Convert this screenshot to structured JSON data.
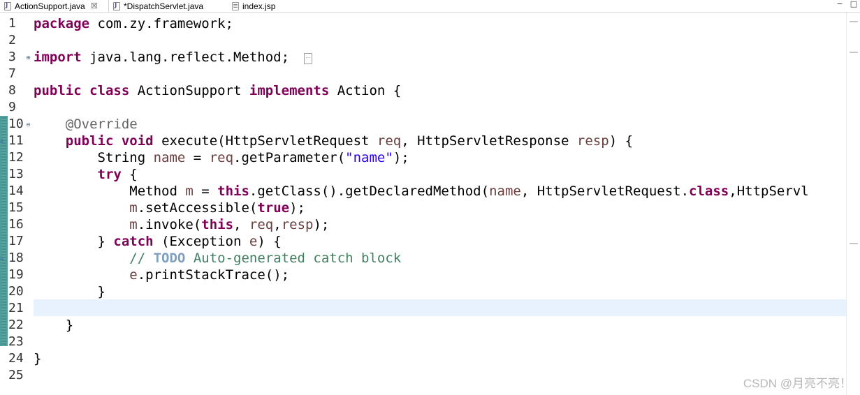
{
  "tabs": [
    {
      "label": "ActionSupport.java",
      "icon": "java-file-icon",
      "active": true,
      "close": "☒"
    },
    {
      "label": "*DispatchServlet.java",
      "icon": "java-file-icon",
      "active": false
    },
    {
      "label": "index.jsp",
      "icon": "jsp-file-icon",
      "active": false
    }
  ],
  "window_controls": {
    "minimize": "−",
    "maximize": "□"
  },
  "editor": {
    "current_line": 21,
    "lines": [
      {
        "n": "1"
      },
      {
        "n": "2"
      },
      {
        "n": "3"
      },
      {
        "n": "7"
      },
      {
        "n": "8"
      },
      {
        "n": "9"
      },
      {
        "n": "10"
      },
      {
        "n": "11"
      },
      {
        "n": "12"
      },
      {
        "n": "13"
      },
      {
        "n": "14"
      },
      {
        "n": "15"
      },
      {
        "n": "16"
      },
      {
        "n": "17"
      },
      {
        "n": "18"
      },
      {
        "n": "19"
      },
      {
        "n": "20"
      },
      {
        "n": "21"
      },
      {
        "n": "22"
      },
      {
        "n": "23"
      },
      {
        "n": "24"
      },
      {
        "n": "25"
      }
    ],
    "tokens": {
      "l1": [
        [
          "kw",
          "package"
        ],
        [
          "plain",
          " com.zy.framework;"
        ]
      ],
      "l3": [
        [
          "kw",
          "import"
        ],
        [
          "plain",
          " java.lang.reflect.Method;"
        ]
      ],
      "l8": [
        [
          "kw",
          "public"
        ],
        [
          "plain",
          " "
        ],
        [
          "kw",
          "class"
        ],
        [
          "plain",
          " ActionSupport "
        ],
        [
          "kw",
          "implements"
        ],
        [
          "plain",
          " Action {"
        ]
      ],
      "l10": [
        [
          "plain",
          "    "
        ],
        [
          "ann",
          "@Override"
        ]
      ],
      "l11": [
        [
          "plain",
          "    "
        ],
        [
          "kw",
          "public"
        ],
        [
          "plain",
          " "
        ],
        [
          "kw",
          "void"
        ],
        [
          "plain",
          " execute(HttpServletRequest "
        ],
        [
          "var",
          "req"
        ],
        [
          "plain",
          ", HttpServletResponse "
        ],
        [
          "var",
          "resp"
        ],
        [
          "plain",
          ") {"
        ]
      ],
      "l12": [
        [
          "plain",
          "        String "
        ],
        [
          "var",
          "name"
        ],
        [
          "plain",
          " = "
        ],
        [
          "var",
          "req"
        ],
        [
          "plain",
          ".getParameter("
        ],
        [
          "str",
          "\"name\""
        ],
        [
          "plain",
          ");"
        ]
      ],
      "l13": [
        [
          "plain",
          "        "
        ],
        [
          "kw",
          "try"
        ],
        [
          "plain",
          " {"
        ]
      ],
      "l14": [
        [
          "plain",
          "            Method "
        ],
        [
          "var",
          "m"
        ],
        [
          "plain",
          " = "
        ],
        [
          "kw",
          "this"
        ],
        [
          "plain",
          ".getClass().getDeclaredMethod("
        ],
        [
          "var",
          "name"
        ],
        [
          "plain",
          ", HttpServletRequest."
        ],
        [
          "kw",
          "class"
        ],
        [
          "plain",
          ",HttpServl"
        ]
      ],
      "l15": [
        [
          "plain",
          "            "
        ],
        [
          "var",
          "m"
        ],
        [
          "plain",
          ".setAccessible("
        ],
        [
          "kw",
          "true"
        ],
        [
          "plain",
          ");"
        ]
      ],
      "l16": [
        [
          "plain",
          "            "
        ],
        [
          "var",
          "m"
        ],
        [
          "plain",
          ".invoke("
        ],
        [
          "kw",
          "this"
        ],
        [
          "plain",
          ", "
        ],
        [
          "var",
          "req"
        ],
        [
          "plain",
          ","
        ],
        [
          "var",
          "resp"
        ],
        [
          "plain",
          ");"
        ]
      ],
      "l17": [
        [
          "plain",
          "        } "
        ],
        [
          "kw",
          "catch"
        ],
        [
          "plain",
          " (Exception "
        ],
        [
          "var",
          "e"
        ],
        [
          "plain",
          ") {"
        ]
      ],
      "l18": [
        [
          "plain",
          "            "
        ],
        [
          "cmt",
          "// "
        ],
        [
          "todo",
          "TODO"
        ],
        [
          "cmt",
          " Auto-generated catch block"
        ]
      ],
      "l19": [
        [
          "plain",
          "            "
        ],
        [
          "var",
          "e"
        ],
        [
          "plain",
          ".printStackTrace();"
        ]
      ],
      "l20": [
        [
          "plain",
          "        }"
        ]
      ],
      "l21": [
        [
          "plain",
          ""
        ]
      ],
      "l22": [
        [
          "plain",
          "    }"
        ]
      ],
      "l24": [
        [
          "plain",
          "}"
        ]
      ]
    },
    "fold_collapsed_marker": "…",
    "fold_expand_glyph": "⊕",
    "fold_collapse_glyph": "⊖",
    "override_glyph": "▵"
  },
  "watermark": "CSDN @月亮不亮！",
  "colors": {
    "keyword": "#7f0055",
    "string": "#2a00ff",
    "annotation": "#646464",
    "local_variable": "#6a3e3e",
    "comment": "#3f7f5f",
    "todo": "#7f9fbf",
    "current_line_bg": "#e8f2fe",
    "change_marker": "#4f9d9a"
  }
}
